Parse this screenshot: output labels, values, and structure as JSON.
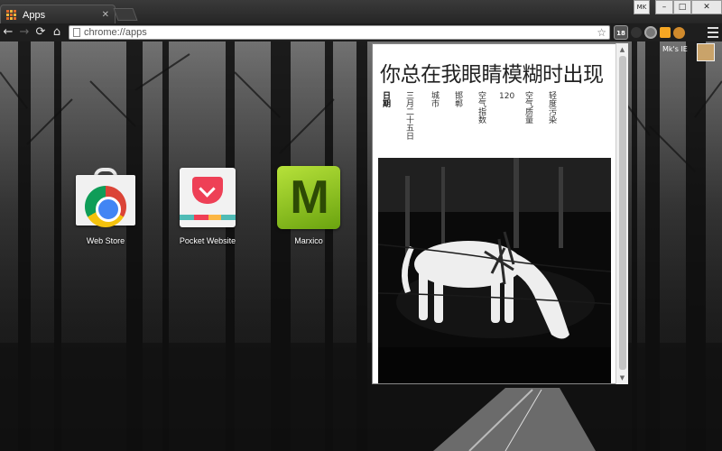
{
  "tab": {
    "title": "Apps"
  },
  "window_controls": {
    "profile": "MK",
    "minimize": "–",
    "maximize": "□",
    "close": "✕"
  },
  "toolbar": {
    "back": "←",
    "forward": "→",
    "reload": "⟳",
    "home": "⌂",
    "url": "chrome://apps",
    "star": "☆",
    "weather_ext": "18"
  },
  "apps": [
    {
      "label": "Web Store",
      "icon": "web-store-icon"
    },
    {
      "label": "Pocket Website",
      "icon": "pocket-icon"
    },
    {
      "label": "Marxico",
      "icon": "marxico-icon",
      "glyph": "M"
    }
  ],
  "popup": {
    "title": "你总在我眼睛模糊时出现",
    "columns": [
      {
        "text": "日期",
        "bold": true
      },
      {
        "text": "三月二十五日",
        "bold": false
      },
      {
        "text": "城市",
        "bold": false
      },
      {
        "text": "邯郸",
        "bold": false
      },
      {
        "text": "空气指数",
        "bold": false
      },
      {
        "text": "120",
        "bold": false
      },
      {
        "text": "空气质量",
        "bold": false
      },
      {
        "text": "轻度污染",
        "bold": false
      }
    ]
  },
  "user": {
    "name": "Mk's IE"
  },
  "colors": {
    "pocket": "#ee4056",
    "marxico": "#8cc520",
    "chrome_frame": "#262626"
  }
}
